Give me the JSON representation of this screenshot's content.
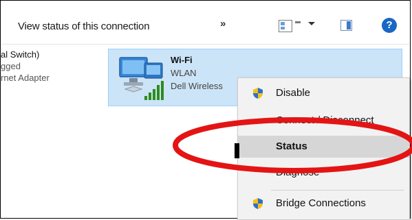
{
  "toolbar": {
    "status_text": "View status of this connection",
    "more": "»",
    "help": "?"
  },
  "left_item": {
    "name": "al Switch)",
    "status": "gged",
    "adapter": "rnet Adapter"
  },
  "connection": {
    "name": "Wi-Fi",
    "network": "WLAN",
    "adapter": "Dell Wireless"
  },
  "context_menu": {
    "items": [
      {
        "label": "Disable",
        "icon": "shield-icon"
      },
      {
        "label": "Connect / Disconnect",
        "icon": ""
      },
      {
        "label": "Status",
        "icon": ""
      },
      {
        "label": "Diagnose",
        "icon": ""
      },
      {
        "label": "Bridge Connections",
        "icon": "shield-icon"
      }
    ],
    "selected": "Status"
  },
  "colors": {
    "selection_bg": "#cce4f7",
    "highlight_ellipse": "#e41414",
    "menu_bg": "#f2f2f2"
  }
}
